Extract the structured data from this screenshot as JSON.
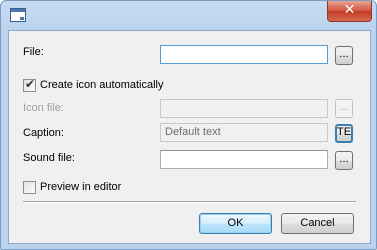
{
  "window": {
    "title": "",
    "close_symbol": "✕"
  },
  "form": {
    "file_label": "File:",
    "file_value": "",
    "browse_label": "...",
    "create_icon_label": "Create icon automatically",
    "create_icon_checked": true,
    "icon_file_label": "Icon file:",
    "icon_file_value": "",
    "caption_label": "Caption:",
    "caption_placeholder": "Default text",
    "caption_btn_label": "TE",
    "sound_file_label": "Sound file:",
    "sound_file_value": "",
    "preview_label": "Preview in editor",
    "preview_checked": false
  },
  "buttons": {
    "ok": "OK",
    "cancel": "Cancel"
  }
}
